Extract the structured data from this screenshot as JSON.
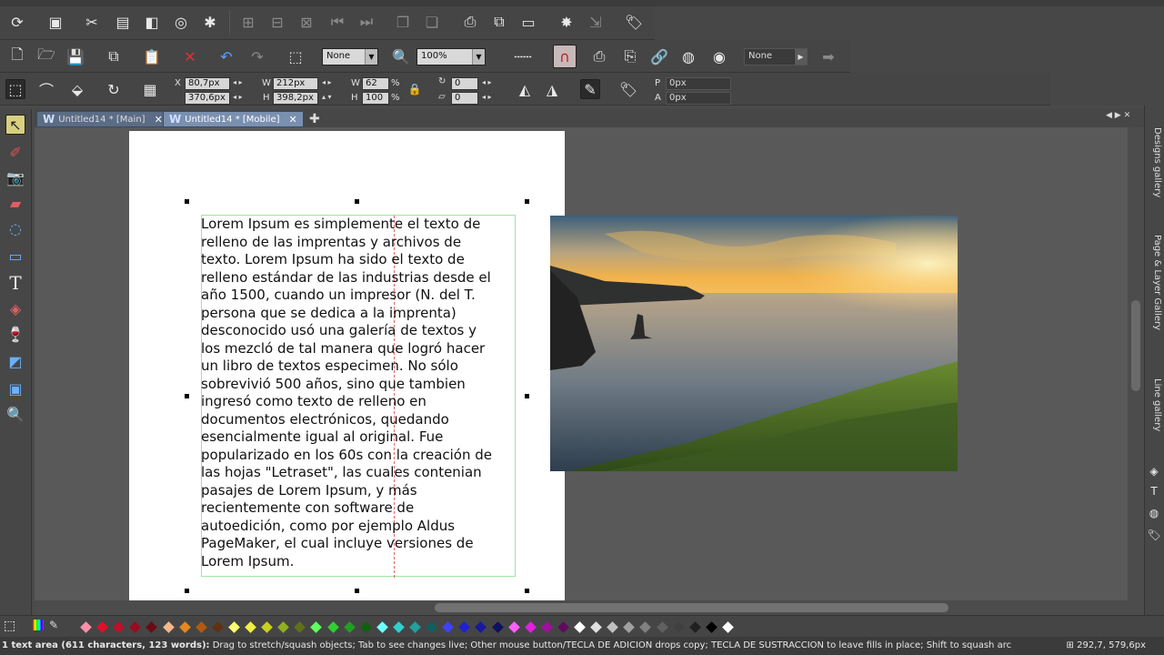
{
  "toolbar": {
    "line_style": "None",
    "zoom": "100%",
    "fill_style": "None"
  },
  "infobar": {
    "x_label": "X",
    "x_value": "80,7px",
    "y_value": "370,6px",
    "w_label": "W",
    "w_value": "212px",
    "h_label": "H",
    "h_value": "398,2px",
    "scale_w_label": "W",
    "scale_w_value": "62",
    "scale_h_label": "H",
    "scale_h_value": "100",
    "pct": "%",
    "rotate_value": "0",
    "skew_value": "0",
    "p_label": "P",
    "p_value": "0px",
    "a_label": "A",
    "a_value": "0px"
  },
  "tabs": [
    {
      "label": "Untitled14 * [Main]"
    },
    {
      "label": "Untitled14 * [Mobile]"
    }
  ],
  "document": {
    "text": "Lorem Ipsum es simplemente el texto de\nrelleno de las imprentas y archivos de\ntexto. Lorem Ipsum ha sido el texto de\nrelleno estándar de las industrias desde el\naño 1500, cuando un impresor (N. del T.\npersona que se dedica a la imprenta)\ndesconocido usó una galería de textos y\nlos mezcló de tal manera que logró hacer\nun libro de textos especimen. No sólo\nsobrevivió 500 años, sino que tambien\ningresó como texto de relleno en\ndocumentos electrónicos, quedando\nesencialmente igual al original. Fue\npopularizado en los 60s con la creación de\nlas hojas \"Letraset\", las cuales contenian\npasajes de Lorem Ipsum, y más\nrecientemente con software de\nautoedición, como por ejemplo Aldus\nPageMaker, el cual incluye versiones de\nLorem Ipsum."
  },
  "gallery": {
    "designs": "Designs gallery",
    "page_layer": "Page & Layer Gallery",
    "line": "Line gallery"
  },
  "palette_colors": [
    "#ff8fa8",
    "#e0102a",
    "#c0102a",
    "#9a0a20",
    "#6a0a18",
    "#f5b78a",
    "#e8861e",
    "#b35a10",
    "#603010",
    "#ffff70",
    "#f0f040",
    "#c8d020",
    "#90b020",
    "#607018",
    "#60ff60",
    "#30d030",
    "#20a020",
    "#106010",
    "#70ffff",
    "#30d0d0",
    "#20a0a0",
    "#106060",
    "#4040ff",
    "#2020d0",
    "#1818a0",
    "#101060",
    "#ff60ff",
    "#e020e0",
    "#a010a0",
    "#600a60",
    "#ffffff",
    "#e0e0e0",
    "#c0c0c0",
    "#a0a0a0",
    "#808080",
    "#606060",
    "#404040",
    "#202020",
    "#000000",
    "#ffffff"
  ],
  "status": {
    "selection": "1 text area (611 characters, 123 words):",
    "hint": " Drag to stretch/squash objects; Tab to see changes live; Other mouse button/TECLA DE ADICION drops copy; TECLA DE SUSTRACCION to leave fills in place; Shift to squash arc",
    "coords": "292,7, 579,6px"
  }
}
